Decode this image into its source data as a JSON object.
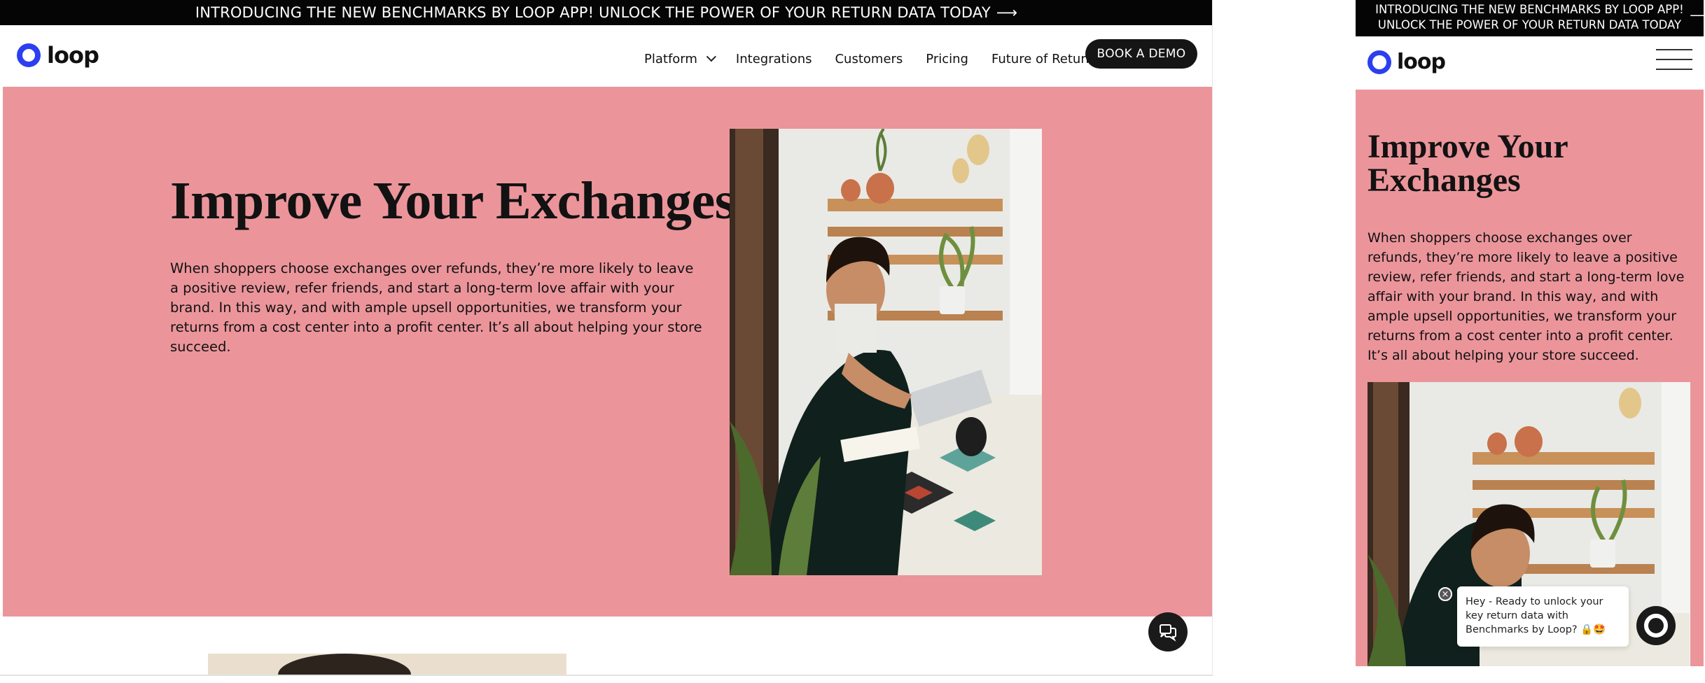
{
  "announcement": {
    "text": "INTRODUCING THE NEW BENCHMARKS BY LOOP APP! UNLOCK THE POWER OF YOUR RETURN DATA TODAY",
    "arrow": "⟶"
  },
  "brand": {
    "name": "loop",
    "accent_color": "#2b3ff0"
  },
  "nav": {
    "items": [
      "Platform",
      "Integrations",
      "Customers",
      "Pricing",
      "Future of Returns"
    ],
    "cta_label": "BOOK A DEMO"
  },
  "hero": {
    "title": "Improve Your Exchanges",
    "body": "When shoppers choose exchanges over refunds, they’re more likely to leave a positive review, refer friends, and start a long-term love affair with your brand. In this way, and with ample upsell opportunities, we transform your returns from a cost center into a profit center. It’s all about helping your store succeed.",
    "background_color": "#eb959b"
  },
  "chat_widget": {
    "message": "Hey - Ready to unlock your key return data with Benchmarks by Loop? 🔒🤩",
    "close_symbol": "×"
  }
}
